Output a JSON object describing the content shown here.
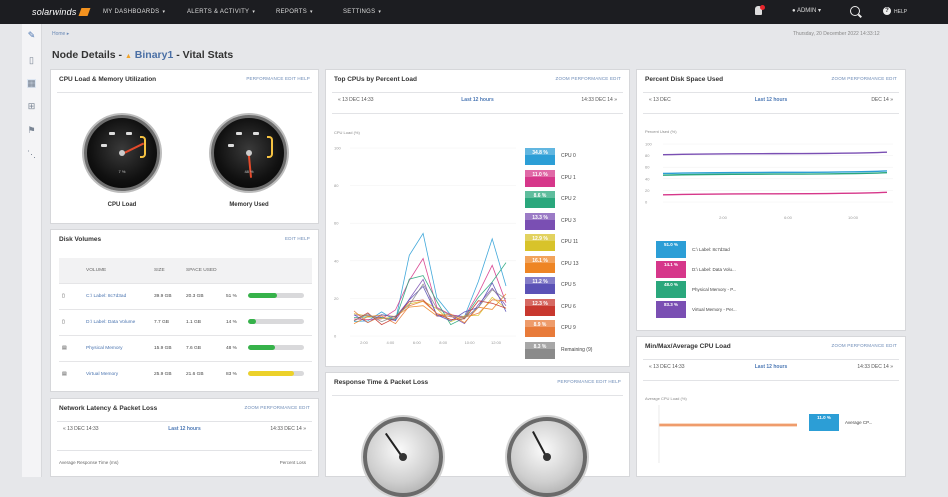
{
  "topbar": {
    "brand": "solarwinds",
    "nav": [
      "MY DASHBOARDS",
      "ALERTS & ACTIVITY",
      "REPORTS",
      "SETTINGS"
    ],
    "user": "ADMIN",
    "help": "HELP"
  },
  "breadcrumb": "Home",
  "page_title": {
    "prefix": "Node Details -",
    "node": "Binary1",
    "suffix": "- Vital Stats"
  },
  "datetime": "Thursday, 20 December 2022 14:33:12",
  "cpu_memory": {
    "title": "CPU Load & Memory Utilization",
    "links": "PERFORMANCE  EDIT  HELP",
    "gauges": [
      {
        "label": "CPU Load",
        "value": "7 %",
        "fraction": 0.07
      },
      {
        "label": "Memory Used",
        "value": "48 %",
        "fraction": 0.48
      }
    ]
  },
  "disk_volumes": {
    "title": "Disk Volumes",
    "links": "EDIT  HELP",
    "headers": [
      "",
      "VOLUME",
      "SIZE",
      "SPACE USED",
      "",
      ""
    ],
    "rows": [
      {
        "icon": "▯",
        "name": "C:\\ Label: 8c7d3ad",
        "size": "39.9 GB",
        "used": "20.3 GB",
        "pct": "51 %",
        "fraction": 0.51,
        "color": "#36b24a"
      },
      {
        "icon": "▯",
        "name": "D:\\ Label: Data Volume",
        "size": "7.7 GB",
        "used": "1.1 GB",
        "pct": "14 %",
        "fraction": 0.14,
        "color": "#36b24a"
      },
      {
        "icon": "▤",
        "name": "Physical Memory",
        "size": "15.9 GB",
        "used": "7.6 GB",
        "pct": "48 %",
        "fraction": 0.48,
        "color": "#36b24a"
      },
      {
        "icon": "▤",
        "name": "Virtual Memory",
        "size": "25.9 GB",
        "used": "21.6 GB",
        "pct": "83 %",
        "fraction": 0.83,
        "color": "#ecd12a"
      }
    ]
  },
  "latency": {
    "title": "Network Latency & Packet Loss",
    "links": "ZOOM  PERFORMANCE  EDIT",
    "range": "Last 12 hours",
    "left": "« 13 DEC 14:33",
    "right": "14:33 DEC 14 »",
    "footer_left": "Average Response Time (ms)",
    "footer_right": "Percent Loss"
  },
  "top_cpus": {
    "title": "Top CPUs by Percent Load",
    "links": "ZOOM  PERFORMANCE  EDIT",
    "range": "Last 12 hours",
    "left": "« 13 DEC 14:33",
    "right": "14:33 DEC 14 »",
    "ylabel": "CPU Load (%)",
    "y_ticks": [
      "100",
      "80",
      "60",
      "40",
      "20",
      "0"
    ],
    "x_ticks": [
      "2:00",
      "4:00",
      "6:00",
      "8:00",
      "10:00",
      "12:00"
    ],
    "legend": [
      {
        "value": "34.8 %",
        "label": "CPU 0",
        "color": "#2c9ed6"
      },
      {
        "value": "11.0 %",
        "label": "CPU 1",
        "color": "#d6378a"
      },
      {
        "value": "8.6 %",
        "label": "CPU 2",
        "color": "#2aa77c"
      },
      {
        "value": "13.3 %",
        "label": "CPU 3",
        "color": "#7a4fb3"
      },
      {
        "value": "12.9 %",
        "label": "CPU 11",
        "color": "#d8c32a"
      },
      {
        "value": "16.1 %",
        "label": "CPU 13",
        "color": "#ee8524"
      },
      {
        "value": "11.2 %",
        "label": "CPU 5",
        "color": "#5b52b6"
      },
      {
        "value": "12.3 %",
        "label": "CPU 6",
        "color": "#c8382f"
      },
      {
        "value": "8.9 %",
        "label": "CPU 9",
        "color": "#e87b3a"
      },
      {
        "value": "8.3 %",
        "label": "Remaining (9)",
        "color": "#8a8a8a"
      }
    ]
  },
  "response_time": {
    "title": "Response Time & Packet Loss",
    "links": "PERFORMANCE  EDIT  HELP"
  },
  "disk_space": {
    "title": "Percent Disk Space Used",
    "links": "ZOOM  PERFORMANCE  EDIT",
    "range": "Last 12 hours",
    "left": "« 13 DEC",
    "right": "DEC 14 »",
    "ylabel": "Percent Used (%)",
    "y_ticks": [
      "100",
      "80",
      "60",
      "40",
      "20",
      "0"
    ],
    "x_ticks": [
      "2:00",
      "6:00",
      "10:00"
    ],
    "legend": [
      {
        "value": "51.0 %",
        "label": "C:\\ Label: 8c7d3ad",
        "color": "#2c9ed6"
      },
      {
        "value": "14.1 %",
        "label": "D:\\ Label: Data Volu...",
        "color": "#d6378a"
      },
      {
        "value": "48.0 %",
        "label": "Physical Memory - P...",
        "color": "#2aa77c"
      },
      {
        "value": "83.3 %",
        "label": "Virtual Memory - Per...",
        "color": "#7a4fb3"
      }
    ]
  },
  "min_max_cpu": {
    "title": "Min/Max/Average CPU Load",
    "links": "ZOOM  PERFORMANCE  EDIT",
    "range": "Last 12 hours",
    "left": "« 13 DEC 14:33",
    "right": "14:33 DEC 14 »",
    "ylabel": "Average CPU Load (%)",
    "legend": [
      {
        "value": "11.0 %",
        "label": "Average CP...",
        "color": "#2c9ed6"
      }
    ]
  }
}
